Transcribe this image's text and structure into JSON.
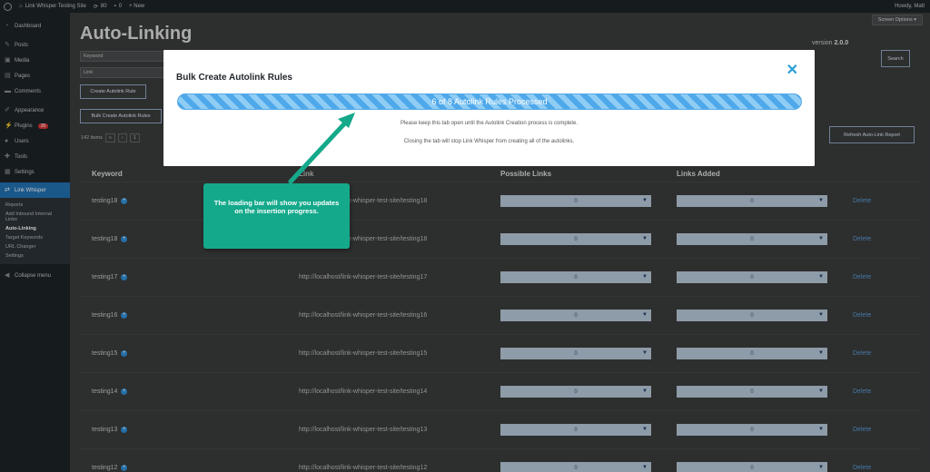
{
  "adminbar": {
    "site_name": "Link Whisper Testing Site",
    "updates_count": "80",
    "comments_count": "0",
    "new_label": "+ New",
    "greeting": "Howdy, Matt"
  },
  "sidebar": {
    "items": [
      {
        "label": "Dashboard",
        "icon": "dashboard-icon"
      },
      {
        "label": "Posts",
        "icon": "pin-icon"
      },
      {
        "label": "Media",
        "icon": "media-icon"
      },
      {
        "label": "Pages",
        "icon": "pages-icon"
      },
      {
        "label": "Comments",
        "icon": "comments-icon"
      },
      {
        "label": "Appearance",
        "icon": "brush-icon"
      },
      {
        "label": "Plugins",
        "icon": "plugin-icon",
        "badge": "35"
      },
      {
        "label": "Users",
        "icon": "users-icon"
      },
      {
        "label": "Tools",
        "icon": "wrench-icon"
      },
      {
        "label": "Settings",
        "icon": "settings-icon"
      }
    ],
    "active": {
      "label": "Link Whisper",
      "icon": "link-icon"
    },
    "submenu": [
      "Reports",
      "Add Inbound Internal Links",
      "Auto-Linking",
      "Target Keywords",
      "URL Changer",
      "Settings"
    ],
    "collapse_label": "Collapse menu"
  },
  "page": {
    "screen_options": "Screen Options ▾",
    "title": "Auto-Linking",
    "version_label": "version",
    "version_number": "2.0.0",
    "keyword_placeholder": "Keyword",
    "link_placeholder": "Link",
    "create_button": "Create Autolink Rule",
    "bulk_button": "Bulk Create Autolink Rules",
    "search_button": "Search",
    "refresh_button": "Refresh Auto-Link Report",
    "items_count": "142 items",
    "pager": [
      "«",
      "‹",
      "1"
    ]
  },
  "table": {
    "headers": [
      "Keyword",
      "Link",
      "Possible Links",
      "Links Added"
    ],
    "delete_label": "Delete",
    "rows": [
      {
        "keyword": "testing18",
        "link": "http://localhost/link-whisper-test-site/testing18",
        "possible": "0",
        "added": "0"
      },
      {
        "keyword": "testing18",
        "link": "http://localhost/link-whisper-test-site/testing18",
        "possible": "0",
        "added": "0"
      },
      {
        "keyword": "testing17",
        "link": "http://localhost/link-whisper-test-site/testing17",
        "possible": "0",
        "added": "0"
      },
      {
        "keyword": "testing16",
        "link": "http://localhost/link-whisper-test-site/testing16",
        "possible": "0",
        "added": "0"
      },
      {
        "keyword": "testing15",
        "link": "http://localhost/link-whisper-test-site/testing15",
        "possible": "0",
        "added": "0"
      },
      {
        "keyword": "testing14",
        "link": "http://localhost/link-whisper-test-site/testing14",
        "possible": "0",
        "added": "0"
      },
      {
        "keyword": "testing13",
        "link": "http://localhost/link-whisper-test-site/testing13",
        "possible": "0",
        "added": "0"
      },
      {
        "keyword": "testing12",
        "link": "http://localhost/link-whisper-test-site/testing12",
        "possible": "0",
        "added": "0"
      }
    ]
  },
  "modal": {
    "title": "Bulk Create Autolink Rules",
    "close_icon": "close-icon",
    "progress_text": "6 of 8 Autolink Rules Processed",
    "progress_fraction": 0.75,
    "note_1": "Please keep this tab open until the Autolink Creation process is complete.",
    "note_2": "Closing the tab will stop Link Whisper from creating all of the autolinks."
  },
  "callout": {
    "text": "The loading bar will show you updates on the insertion progress."
  },
  "colors": {
    "accent": "#2271b1",
    "progress": "#4ea8ea",
    "callout": "#14a98b"
  }
}
